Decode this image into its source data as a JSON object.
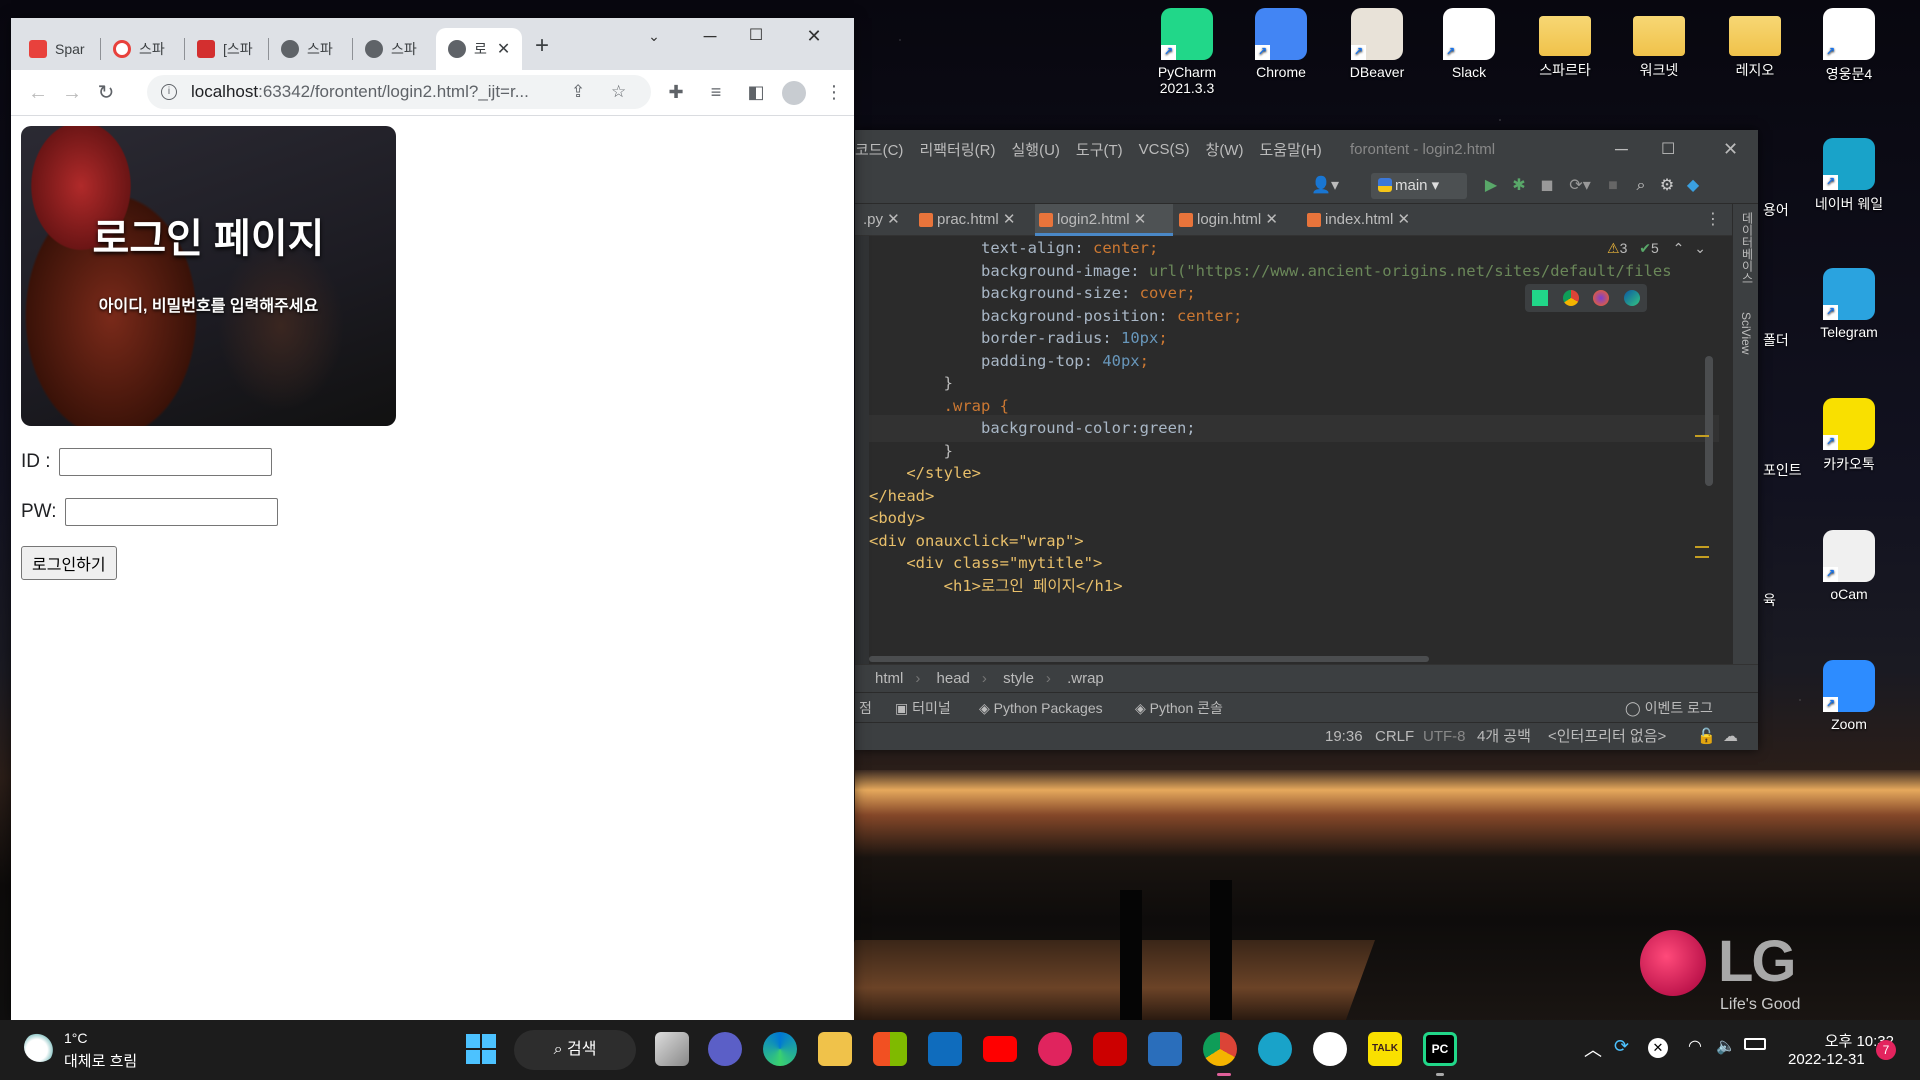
{
  "browser": {
    "tabs": [
      {
        "label": "Spar",
        "color": "#e8413c"
      },
      {
        "label": "스파",
        "color": "#e8413c"
      },
      {
        "label": "[스파",
        "color": "#d32f2f"
      },
      {
        "label": "스파",
        "color": "#5f6368"
      },
      {
        "label": "스파",
        "color": "#5f6368"
      },
      {
        "label": "로",
        "color": "#5f6368"
      }
    ],
    "url_host": "localhost",
    "url_path": ":63342/forontent/login2.html?_ijt=r...",
    "page": {
      "title": "로그인 페이지",
      "subtitle": "아이디, 비밀번호를 입력해주세요",
      "id_label": "ID :",
      "pw_label": "PW:",
      "login_button": "로그인하기"
    }
  },
  "ide": {
    "menu": [
      "코드(C)",
      "리팩터링(R)",
      "실행(U)",
      "도구(T)",
      "VCS(S)",
      "창(W)",
      "도움말(H)"
    ],
    "window_title": "forontent - login2.html",
    "run_config": "main",
    "tabs": [
      ".py",
      "prac.html",
      "login2.html",
      "login.html",
      "index.html"
    ],
    "inspections": {
      "warnings": "3",
      "ok": "5"
    },
    "code": [
      {
        "indent": "            ",
        "prop": "text-align",
        "value": "center",
        "vtype": "k"
      },
      {
        "indent": "            ",
        "prop": "background-image",
        "value": "url(\"https://www.ancient-origins.net/sites/default/files",
        "vtype": "url"
      },
      {
        "indent": "            ",
        "prop": "background-size",
        "value": "cover",
        "vtype": "k"
      },
      {
        "indent": "            ",
        "prop": "background-position",
        "value": "center",
        "vtype": "k"
      },
      {
        "indent": "            ",
        "prop": "border-radius",
        "value": "10px",
        "vtype": "n"
      },
      {
        "indent": "            ",
        "prop": "padding-top",
        "value": "40px",
        "vtype": "n"
      }
    ],
    "code_raw": [
      "        }",
      "        .wrap {",
      "            background-color:green;",
      "        }",
      "    </style>",
      "</head>",
      "<body>",
      "<div onauxclick=\"wrap\">",
      "    <div class=\"mytitle\">",
      "        <h1>로그인 페이지</h1>"
    ],
    "breadcrumb": [
      "html",
      "head",
      "style",
      ".wrap"
    ],
    "bottom_tools": [
      "점",
      "터미널",
      "Python Packages",
      "Python 콘솔",
      "이벤트 로그"
    ],
    "status": {
      "pos": "19:36",
      "eol": "CRLF",
      "enc": "UTF-8",
      "indent": "4개 공백",
      "interp": "<인터프리터 없음>"
    },
    "side_labels": [
      "데이터베이스",
      "SciView"
    ]
  },
  "desktop": {
    "icons": [
      {
        "label": "PyCharm\n2021.3.3",
        "color": "#21d789"
      },
      {
        "label": "Chrome",
        "color": "#4285f4"
      },
      {
        "label": "DBeaver",
        "color": "#e8e2d8"
      },
      {
        "label": "Slack",
        "color": "#ffffff"
      },
      {
        "label": "스파르타",
        "color": "folder"
      },
      {
        "label": "워크넷",
        "color": "folder"
      },
      {
        "label": "레지오",
        "color": "folder"
      },
      {
        "label": "영웅문4",
        "color": "#ffffff"
      },
      {
        "label": "네이버 웨일",
        "color": "#19a3c9"
      },
      {
        "label": "Telegram",
        "color": "#2aa3df"
      },
      {
        "label": "카카오톡",
        "color": "#f9e000"
      },
      {
        "label": "oCam",
        "color": "#f0f0f0"
      },
      {
        "label": "Zoom",
        "color": "#2d8cff"
      }
    ],
    "partial_labels": [
      "용어",
      "폴더",
      "포인트",
      "육"
    ],
    "brand": {
      "name": "LG",
      "slogan": "Life's Good"
    }
  },
  "taskbar": {
    "weather_temp": "1°C",
    "weather_desc": "대체로 흐림",
    "search": "검색",
    "time": "오후 10:32",
    "date": "2022-12-31",
    "notif_count": "7"
  }
}
